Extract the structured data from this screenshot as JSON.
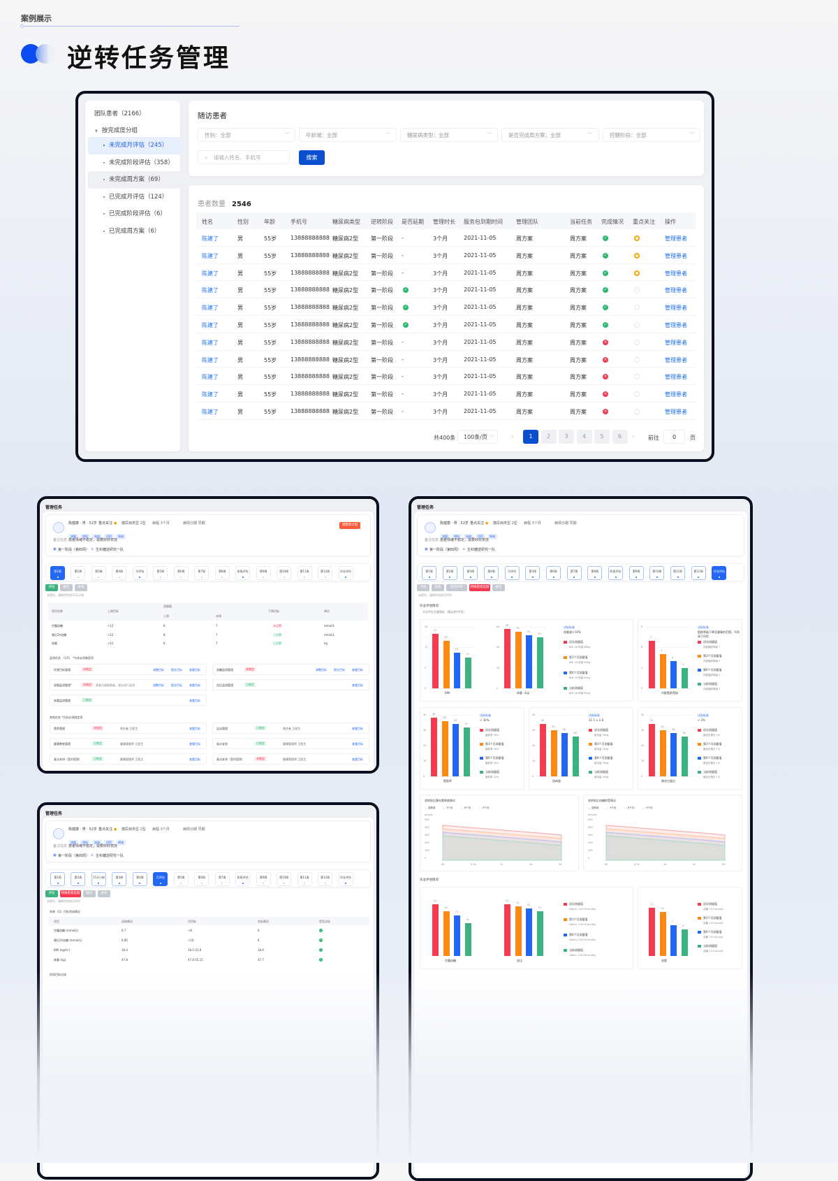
{
  "header": {
    "section_label": "案例展示",
    "title": "逆转任务管理"
  },
  "sidebar": {
    "root": "团队患者（2166）",
    "group": "按完成度分组",
    "items": [
      "未完成月评估（245）",
      "未完成阶段评估（358）",
      "未完成周方案（69）",
      "已完成月评估（124）",
      "已完成阶段评估（6）",
      "已完成周方案（6）"
    ],
    "active_index": 0,
    "hover_index": 2
  },
  "filters": {
    "title": "随访患者",
    "selects": [
      "性别：全部",
      "年龄端：全部",
      "糖尿病类型：全部",
      "是否完成周方案：全部",
      "控糖阶段：全部"
    ],
    "search_placeholder": "请输入姓名、手机号",
    "search_button": "搜索"
  },
  "table": {
    "count_label": "患者数量",
    "count": "2546",
    "columns": [
      "姓名",
      "性别",
      "年龄",
      "手机号",
      "糖尿病类型",
      "逆转阶段",
      "是否延期",
      "管理时长",
      "服务包到期时间",
      "管理团队",
      "当前任务",
      "完成情况",
      "重点关注",
      "操作"
    ],
    "rows": [
      [
        "陈建了",
        "男",
        "55岁",
        "13888888888",
        "糖尿病2型",
        "第一阶段",
        "-",
        "3个月",
        "2021-11-05",
        "周方案",
        "周方案",
        "done",
        "focus",
        "管理患者"
      ],
      [
        "陈建了",
        "男",
        "55岁",
        "13888888888",
        "糖尿病2型",
        "第一阶段",
        "-",
        "3个月",
        "2021-11-05",
        "周方案",
        "周方案",
        "done",
        "focus",
        "管理患者"
      ],
      [
        "陈建了",
        "男",
        "55岁",
        "13888888888",
        "糖尿病2型",
        "第一阶段",
        "-",
        "3个月",
        "2021-11-05",
        "周方案",
        "周方案",
        "done",
        "focus",
        "管理患者"
      ],
      [
        "陈建了",
        "男",
        "55岁",
        "13888888888",
        "糖尿病2型",
        "第一阶段",
        "yes",
        "3个月",
        "2021-11-05",
        "周方案",
        "周方案",
        "done",
        "none",
        "管理患者"
      ],
      [
        "陈建了",
        "男",
        "55岁",
        "13888888888",
        "糖尿病2型",
        "第一阶段",
        "yes",
        "3个月",
        "2021-11-05",
        "周方案",
        "周方案",
        "done",
        "none",
        "管理患者"
      ],
      [
        "陈建了",
        "男",
        "55岁",
        "13888888888",
        "糖尿病2型",
        "第一阶段",
        "yes",
        "3个月",
        "2021-11-05",
        "周方案",
        "周方案",
        "done",
        "none",
        "管理患者"
      ],
      [
        "陈建了",
        "男",
        "55岁",
        "13888888888",
        "糖尿病2型",
        "第一阶段",
        "-",
        "3个月",
        "2021-11-05",
        "周方案",
        "周方案",
        "fail",
        "none",
        "管理患者"
      ],
      [
        "陈建了",
        "男",
        "55岁",
        "13888888888",
        "糖尿病2型",
        "第一阶段",
        "-",
        "3个月",
        "2021-11-05",
        "周方案",
        "周方案",
        "fail",
        "none",
        "管理患者"
      ],
      [
        "陈建了",
        "男",
        "55岁",
        "13888888888",
        "糖尿病2型",
        "第一阶段",
        "-",
        "3个月",
        "2021-11-05",
        "周方案",
        "周方案",
        "fail",
        "none",
        "管理患者"
      ],
      [
        "陈建了",
        "男",
        "55岁",
        "13888888888",
        "糖尿病2型",
        "第一阶段",
        "-",
        "3个月",
        "2021-11-05",
        "周方案",
        "周方案",
        "fail",
        "none",
        "管理患者"
      ],
      [
        "陈建了",
        "男",
        "55岁",
        "13888888888",
        "糖尿病2型",
        "第一阶段",
        "-",
        "3个月",
        "2021-11-05",
        "周方案",
        "周方案",
        "fail",
        "none",
        "管理患者"
      ]
    ]
  },
  "pagination": {
    "total": "共400条",
    "page_size": "100条/页",
    "pages": [
      "1",
      "2",
      "3",
      "4",
      "5",
      "6"
    ],
    "current": "1",
    "goto_label": "前往",
    "goto_value": "0",
    "page_unit": "页"
  },
  "patient": {
    "page_title": "管理任务",
    "name": "陈健康 · 男 · 52岁",
    "focus": "重点关注",
    "info": [
      "糖尿病类型  2型",
      "病程  3个月",
      "病情分期  早期"
    ],
    "tags": [
      "减重",
      "增肌",
      "肾病",
      "用药",
      "情绪"
    ],
    "note_label": "备注信息",
    "note": "患者情绪不稳定，需要好好安抚",
    "stage": "第一阶段（第四周）",
    "team": "生科糖逆研究一队",
    "adjust_button": "调整周计划"
  },
  "panel_a": {
    "steps": [
      "第1周",
      "第2周",
      "第3周",
      "第4周",
      "月评估",
      "第5周",
      "第6周",
      "第7周",
      "第8周",
      "阶段评估",
      "第9周",
      "第10周",
      "第11周",
      "第12周",
      "毕业评估"
    ],
    "current_step": 0,
    "buttons": [
      "评估",
      "报告",
      "发布"
    ],
    "hint": "未提交，请按时完成15天小结",
    "table_headers": [
      "项目名称",
      "上周目标",
      "测量值",
      "下周目标",
      "单位"
    ],
    "sub_headers": [
      "上周",
      "本周"
    ],
    "rows": [
      [
        "空腹血糖",
        "<12",
        "8",
        "7",
        "未设置",
        "mmol/L"
      ],
      [
        "餐后2h血糖",
        "<12",
        "8",
        "7",
        "已设置",
        "mmol/L"
      ],
      [
        "体重",
        "<12",
        "8",
        "7",
        "已设置",
        "kg"
      ]
    ],
    "monitor_title": "监测任务 （1/5） *为非必须制定项",
    "monitor": [
      [
        "饮食目标管理",
        "未制定",
        ""
      ],
      [
        "血糖监测管理",
        "未制定",
        ""
      ],
      [
        "尿酮监测管理*",
        "未制定",
        "患者为减脂患者，建议进行监测"
      ],
      [
        "血压监测管理",
        "已制定",
        ""
      ],
      [
        "体重监测管理",
        "已制定",
        ""
      ]
    ],
    "actions": [
      "调整目标",
      "提交目标",
      "查看目标"
    ],
    "other_title": "其他任务 *为非必须制定项",
    "other": [
      [
        "营养管理",
        "未制定",
        "责任者  王医生"
      ],
      [
        "运动管理",
        "已制定",
        "责任者  王医生"
      ],
      [
        "健康教育管理",
        "已制定",
        "健康管理师  王医生"
      ],
      [
        "复诊安排",
        "已制定",
        "健康管理师  王医生"
      ],
      [
        "复诊安排（签约医院）",
        "已制定",
        "健康管理师  王医生"
      ],
      [
        "复诊安排（签约医院）",
        "未制定",
        "健康管理师  王医生"
      ]
    ]
  },
  "panel_b": {
    "steps": [
      "第1周",
      "第2周",
      "15天小结",
      "第3周",
      "第4周",
      "月评估",
      "第5周",
      "第6周",
      "第7周",
      "阶段评估",
      "第9周",
      "第10周",
      "第11周",
      "第12周",
      "毕业评估"
    ],
    "current_step": 5,
    "buttons": [
      "评估",
      "特殊患者延期",
      "报告",
      "发布"
    ],
    "hint": "未提交，请按时完成月评估",
    "section": "系统（月）目标完成情况",
    "headers": [
      "项目",
      "初始情况",
      "月目标",
      "实际情况",
      "是否达标"
    ],
    "rows": [
      [
        "空腹血糖 (mmol/L)",
        "6.7",
        "<8",
        "6"
      ],
      [
        "餐后2h血糖 (mmol/L)",
        "6.85",
        "<10",
        "6"
      ],
      [
        "BMI (kg/m²)",
        "18.4",
        "18.5-23.9",
        "18.9"
      ],
      [
        "体重 (kg)",
        "47.8",
        "47.8-55.15",
        "47.7"
      ]
    ],
    "section2": "阶段目标达成"
  },
  "panel_c": {
    "steps": [
      "第1周",
      "第2周",
      "第3周",
      "第4周",
      "月评估",
      "第5周",
      "第6周",
      "第7周",
      "第8周",
      "阶段评估",
      "第9周",
      "第10周",
      "第11周",
      "第12周",
      "毕业评估"
    ],
    "current_step": 14,
    "buttons": [
      "评估",
      "延期",
      "逆转评审",
      "特殊患者延期",
      "报告"
    ],
    "hint": "未提交，请按时完成月评估",
    "section": "毕业评估情况",
    "sub": "毕业评估主要指标（满足其中5项）",
    "legend": [
      "初次测量值",
      "第3个月测量值",
      "第6个月测量值",
      "当前测量值"
    ],
    "bar_colors": [
      "#f53b50",
      "#fb8a12",
      "#2166f5",
      "#3bb27f"
    ],
    "charts": [
      {
        "label": "BMI",
        "yticks": [
          "0",
          "9",
          "17",
          "26"
        ],
        "ymax": 26,
        "values": [
          23,
          20,
          15,
          13
        ],
        "std_label": "达标标准",
        "std": "体重减少10%",
        "legend_values": [
          "BMI 28  体重 68kg",
          "BMI 25  体重 65kg",
          "BMI 20  体重 62kg",
          "BMI 18  体重 60kg"
        ]
      },
      {
        "label": "体重（kg）",
        "yticks": [
          "0",
          "20",
          "40",
          "60"
        ],
        "ymax": 60,
        "values": [
          58,
          55,
          52,
          50
        ]
      },
      {
        "label": "内脏脂肪等级",
        "yticks": [
          "0",
          "3",
          "6",
          "9"
        ],
        "ymax": 9,
        "values": [
          7,
          5,
          4,
          3
        ],
        "std_label": "达标标准",
        "std": "脂肪等级下降至健康的范围，不再高于风险",
        "legend_values": [
          "内脏脂肪等级 7",
          "内脏脂肪等级 5",
          "内脏脂肪等级 4",
          "内脏脂肪等级 3"
        ]
      },
      {
        "label": "脂肪率",
        "yticks": [
          "0",
          "10",
          "20",
          "30",
          "40"
        ],
        "ymax": 40,
        "values": [
          38,
          36,
          34,
          32
        ],
        "std_label": "达标标准",
        "std": "< 30%",
        "legend_values": [
          "脂肪率 38%",
          "脂肪率 36%",
          "脂肪率 34%",
          "脂肪率 32%"
        ]
      },
      {
        "label": "肌肉量",
        "yticks": [
          "0",
          "10",
          "20",
          "30",
          "40"
        ],
        "ymax": 40,
        "values": [
          34,
          30,
          28,
          26
        ],
        "std_label": "达标标准",
        "std": "31.5 ± 2.8",
        "legend_values": [
          "肌肉量 30kg",
          "肌肉量 30kg",
          "肌肉量 30kg",
          "肌肉量 30kg"
        ]
      },
      {
        "label": "微克白蛋白",
        "yticks": [
          "0",
          "10",
          "20",
          "30",
          "40"
        ],
        "ymax": 40,
        "values": [
          34,
          30,
          28,
          26
        ],
        "std_label": "达标标准",
        "std": "< 2%",
        "legend_values": [
          "微克白蛋白 1%",
          "微克白蛋白 1%",
          "微克白蛋白 1%",
          "微克白蛋白 1%"
        ]
      }
    ],
    "line_charts": [
      {
        "title": "逆转前后胰岛素释放情况",
        "unit": "pmol/L",
        "legend": [
          "逆转前",
          "3个月",
          "6个月",
          "9个月"
        ],
        "x": [
          "0h",
          "0.5h",
          "1h",
          "2h",
          "3h"
        ],
        "yticks": [
          "0",
          "100",
          "200",
          "300",
          "400",
          "500"
        ]
      },
      {
        "title": "逆转前后血糖耐受情况",
        "unit": "mmol/L",
        "legend": [
          "逆转前",
          "3个月",
          "6个月",
          "9个月"
        ],
        "x": [
          "0h",
          "0.5h",
          "1h",
          "2h",
          "3h"
        ],
        "yticks": [
          "0",
          "100",
          "200",
          "300",
          "400",
          "500"
        ]
      }
    ],
    "section3": "毕业评估情况",
    "charts2": [
      {
        "label": "空腹血糖",
        "values": [
          22,
          19,
          17,
          14
        ],
        "ymax": 26,
        "legend_values": [
          "HbA1c  120/78 mmHg",
          "HbA1c  120/78 mmHg",
          "HbA1c  120/78 mmHg",
          "HbA1c  120/78 mmHg"
        ]
      },
      {
        "label": "血压",
        "values": [
          22,
          21,
          20,
          19
        ],
        "ymax": 26
      },
      {
        "label": "血脂",
        "values": [
          11,
          10,
          7,
          6
        ],
        "ymax": 14,
        "legend_values": [
          "血糖 119 mmol/L",
          "血糖 119 mmol/L",
          "血糖 119 mmol/L",
          "血糖 119 mmol/L"
        ]
      }
    ]
  }
}
